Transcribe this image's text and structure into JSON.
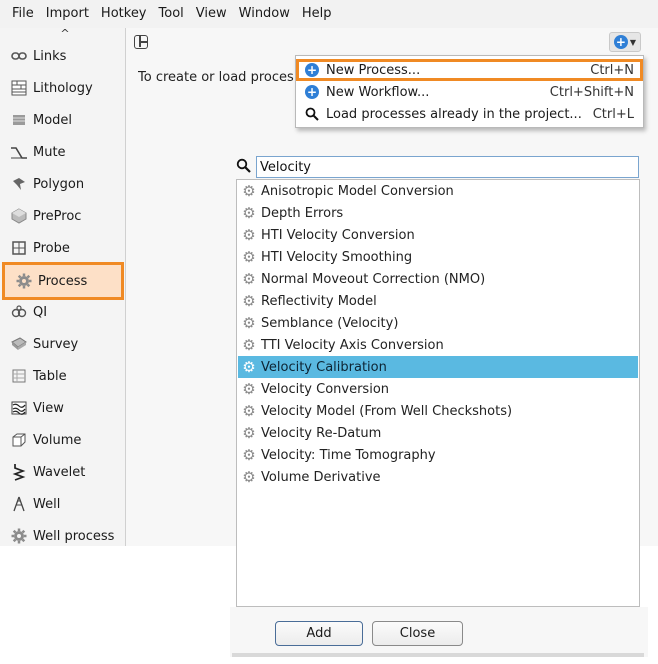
{
  "menubar": {
    "items": [
      "File",
      "Import",
      "Hotkey",
      "Tool",
      "View",
      "Window",
      "Help"
    ]
  },
  "sidebar": {
    "scroll_up_glyph": "^",
    "items": [
      {
        "label": "Links",
        "icon": "links-icon"
      },
      {
        "label": "Lithology",
        "icon": "lithology-icon"
      },
      {
        "label": "Model",
        "icon": "model-icon"
      },
      {
        "label": "Mute",
        "icon": "mute-icon"
      },
      {
        "label": "Polygon",
        "icon": "polygon-icon"
      },
      {
        "label": "PreProc",
        "icon": "preproc-icon"
      },
      {
        "label": "Probe",
        "icon": "probe-icon"
      },
      {
        "label": "Process",
        "icon": "gear-icon",
        "active": true
      },
      {
        "label": "QI",
        "icon": "qi-icon"
      },
      {
        "label": "Survey",
        "icon": "survey-icon"
      },
      {
        "label": "Table",
        "icon": "table-icon"
      },
      {
        "label": "View",
        "icon": "view-icon"
      },
      {
        "label": "Volume",
        "icon": "volume-icon"
      },
      {
        "label": "Wavelet",
        "icon": "wavelet-icon"
      },
      {
        "label": "Well",
        "icon": "well-icon"
      },
      {
        "label": "Well process",
        "icon": "gear-icon"
      }
    ]
  },
  "main": {
    "hint_text": "To create or load processes, use the menu above."
  },
  "dropdown": {
    "items": [
      {
        "label": "New Process...",
        "shortcut": "Ctrl+N",
        "icon": "plus-circle-icon",
        "highlighted": true
      },
      {
        "label": "New Workflow...",
        "shortcut": "Ctrl+Shift+N",
        "icon": "plus-circle-icon"
      },
      {
        "label": "Load processes already in the project...",
        "shortcut": "Ctrl+L",
        "icon": "search-icon"
      }
    ]
  },
  "search": {
    "value": "Velocity",
    "placeholder": ""
  },
  "process_list": {
    "items": [
      "Anisotropic Model Conversion",
      "Depth Errors",
      "HTI Velocity Conversion",
      "HTI Velocity Smoothing",
      "Normal Moveout Correction (NMO)",
      "Reflectivity Model",
      "Semblance (Velocity)",
      "TTI Velocity Axis Conversion",
      "Velocity Calibration",
      "Velocity Conversion",
      "Velocity Model (From Well Checkshots)",
      "Velocity Re-Datum",
      "Velocity: Time Tomography",
      "Volume Derivative"
    ],
    "selected": "Velocity Calibration"
  },
  "buttons": {
    "add": "Add",
    "close": "Close"
  },
  "colors": {
    "accent_orange": "#f08a24",
    "selection_blue": "#5ab9e1",
    "icon_blue": "#2f7fd6"
  }
}
